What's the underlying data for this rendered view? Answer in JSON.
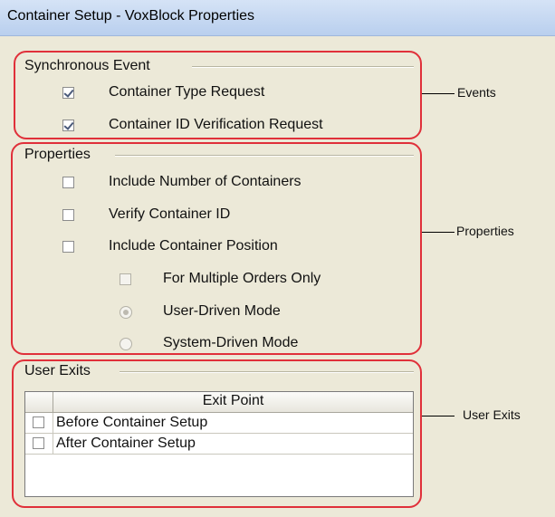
{
  "window": {
    "title": "Container Setup - VoxBlock Properties"
  },
  "synchronous_event": {
    "title": "Synchronous Event",
    "items": [
      {
        "label": "Container Type Request",
        "checked": true
      },
      {
        "label": "Container ID Verification Request",
        "checked": true
      }
    ]
  },
  "properties": {
    "title": "Properties",
    "items": [
      {
        "label": "Include Number of Containers",
        "checked": false
      },
      {
        "label": "Verify Container ID",
        "checked": false
      },
      {
        "label": "Include Container Position",
        "checked": false
      }
    ],
    "sub_items": {
      "for_multiple_orders": {
        "label": "For Multiple Orders Only",
        "checked": false,
        "enabled": false
      },
      "user_driven_mode": {
        "label": "User-Driven Mode",
        "selected": true,
        "enabled": false
      },
      "system_driven_mode": {
        "label": "System-Driven Mode",
        "selected": false,
        "enabled": false
      }
    }
  },
  "user_exits": {
    "title": "User Exits",
    "table": {
      "header": "Exit Point",
      "rows": [
        {
          "label": "Before Container Setup",
          "checked": false
        },
        {
          "label": "After Container Setup",
          "checked": false
        }
      ]
    }
  },
  "annotations": {
    "events": "Events",
    "properties": "Properties",
    "user_exits": "User Exits",
    "color": "#e0303a"
  }
}
